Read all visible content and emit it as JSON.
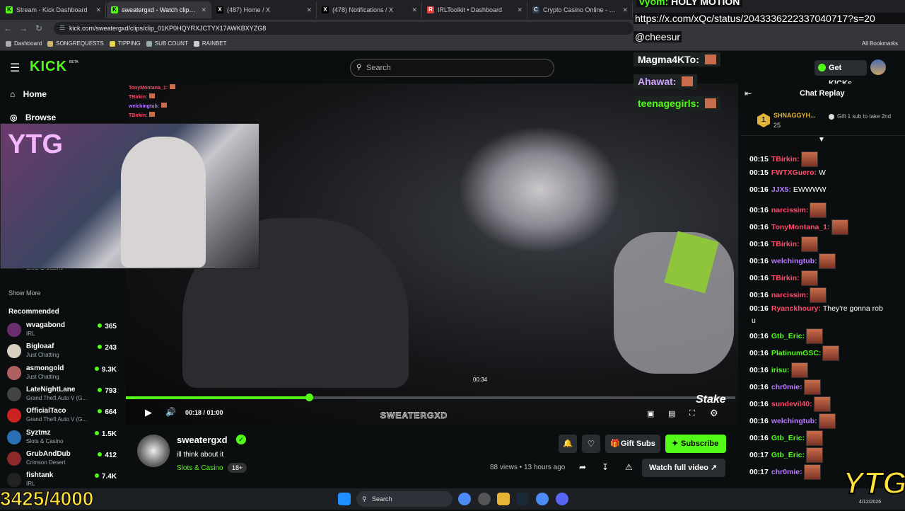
{
  "browser": {
    "tabs": [
      {
        "label": "Stream - Kick Dashboard",
        "fav": "K",
        "color": "#53fc18"
      },
      {
        "label": "sweatergxd - Watch clips on",
        "fav": "K",
        "color": "#53fc18"
      },
      {
        "label": "(487) Home / X",
        "fav": "X",
        "color": "#000000"
      },
      {
        "label": "(478) Notifications / X",
        "fav": "X",
        "color": "#000000"
      },
      {
        "label": "IRLToolkit • Dashboard",
        "fav": "R",
        "color": "#e53935"
      },
      {
        "label": "Crypto Casino Online - Play with",
        "fav": "C",
        "color": "#2d3b4f"
      }
    ],
    "url": "kick.com/sweatergxd/clips/clip_01KP0HQYRXJCTYX17AWKBXYZG8",
    "bookmarks": [
      "Dashboard",
      "SONGREQUESTS",
      "TIPPING",
      "SUB COUNT",
      "RAINBET"
    ],
    "all_bookmarks": "All Bookmarks"
  },
  "kick": {
    "logo": "KICK",
    "beta": "BETA",
    "search_placeholder": "Search",
    "get_kicks": "Get KICKs",
    "nav": {
      "home": "Home",
      "browse": "Browse"
    }
  },
  "sidebar": {
    "partial": {
      "name": "Syztmz",
      "category": "Slots & Casino",
      "viewers": "1.5K"
    },
    "show_more": "Show More",
    "recommended_title": "Recommended",
    "recommended": [
      {
        "name": "wvagabond",
        "category": "IRL",
        "viewers": "365",
        "color": "#6a2d6e"
      },
      {
        "name": "Bigloaaf",
        "category": "Just Chatting",
        "viewers": "243",
        "color": "#d8d0c0"
      },
      {
        "name": "asmongold",
        "category": "Just Chatting",
        "viewers": "9.3K",
        "color": "#b06060"
      },
      {
        "name": "LateNightLane",
        "category": "Grand Theft Auto V (G...",
        "viewers": "793",
        "color": "#444"
      },
      {
        "name": "OfficialTaco",
        "category": "Grand Theft Auto V (G...",
        "viewers": "664",
        "color": "#c22"
      },
      {
        "name": "Syztmz",
        "category": "Slots & Casino",
        "viewers": "1.5K",
        "color": "#2b6fb5"
      },
      {
        "name": "GrubAndDub",
        "category": "Crimson Desert",
        "viewers": "412",
        "color": "#8a2a2a"
      },
      {
        "name": "fishtank",
        "category": "IRL",
        "viewers": "7.4K",
        "color": "#222"
      }
    ]
  },
  "player": {
    "time_current": "00:18",
    "time_total": "01:00",
    "hover_time": "00:34",
    "progress": 0.3,
    "watermark": "SWEATERGXD",
    "stake": "Stake"
  },
  "mini_chat": [
    {
      "u": "TonyMontana_1:",
      "c": "#ff4a6a"
    },
    {
      "u": "TBirkin:",
      "c": "#ff4a6a"
    },
    {
      "u": "welchingtub:",
      "c": "#b77bff"
    },
    {
      "u": "TBirkin:",
      "c": "#ff4a6a"
    }
  ],
  "overlay": {
    "name": "vyom:",
    "msg": "HOLY MOTION",
    "link": "https://x.com/xQc/status/2043336222337040717?s=20",
    "mention": "@cheesur",
    "lines": [
      {
        "u": "Magma4KTo:",
        "c": "#ffffff"
      },
      {
        "u": "Ahawat:",
        "c": "#cfa3ff"
      },
      {
        "u": "teenagegirls:",
        "c": "#53fc18"
      }
    ],
    "counter": "3425/4000",
    "brand": "YTG"
  },
  "clip_info": {
    "channel": "sweatergxd",
    "title": "ill think about it",
    "category": "Slots & Casino",
    "age_badge": "18+",
    "gift_subs": "Gift Subs",
    "subscribe": "Subscribe",
    "views": "88 views",
    "time_ago": "13 hours ago",
    "watch_full": "Watch full video"
  },
  "chat": {
    "title": "Chat Replay",
    "gifter": {
      "name": "SHNAGGYH...",
      "count": "25",
      "rank": "1"
    },
    "gift_cta": "Gift 1 sub to take 2nd",
    "messages": [
      {
        "t": "00:15",
        "u": "TBirkin:",
        "c": "#ff4a6a",
        "text": "",
        "emote": true
      },
      {
        "t": "00:15",
        "u": "FWTXGuero:",
        "c": "#ff4a6a",
        "text": "W",
        "emote": false
      },
      {
        "t": "00:16",
        "u": "JJX5:",
        "c": "#b77bff",
        "text": "EWWWW",
        "emote": false
      },
      {
        "t": "00:16",
        "u": "narcissim:",
        "c": "#ff4a6a",
        "text": "",
        "emote": true
      },
      {
        "t": "00:16",
        "u": "TonyMontana_1:",
        "c": "#ff4a6a",
        "text": "",
        "emote": true
      },
      {
        "t": "00:16",
        "u": "TBirkin:",
        "c": "#ff4a6a",
        "text": "",
        "emote": true
      },
      {
        "t": "00:16",
        "u": "welchingtub:",
        "c": "#b77bff",
        "text": "",
        "emote": true
      },
      {
        "t": "00:16",
        "u": "TBirkin:",
        "c": "#ff4a6a",
        "text": "",
        "emote": true
      },
      {
        "t": "00:16",
        "u": "narcissim:",
        "c": "#ff4a6a",
        "text": "",
        "emote": true
      },
      {
        "t": "00:16",
        "u": "Ryanckhoury:",
        "c": "#ff4a6a",
        "text": "They're gonna rob",
        "emote": false
      },
      {
        "t": "",
        "u": "",
        "c": "#fff",
        "text": "u",
        "emote": false
      },
      {
        "t": "00:16",
        "u": "Gtb_Eric:",
        "c": "#53fc18",
        "text": "",
        "emote": true
      },
      {
        "t": "00:16",
        "u": "PlatinumGSC:",
        "c": "#53fc18",
        "text": "",
        "emote": true
      },
      {
        "t": "00:16",
        "u": "irisu:",
        "c": "#53fc18",
        "text": "",
        "emote": true
      },
      {
        "t": "00:16",
        "u": "chr0mie:",
        "c": "#b77bff",
        "text": "",
        "emote": true
      },
      {
        "t": "00:16",
        "u": "sundevil40:",
        "c": "#ff4a6a",
        "text": "",
        "emote": true
      },
      {
        "t": "00:16",
        "u": "welchingtub:",
        "c": "#b77bff",
        "text": "",
        "emote": true
      },
      {
        "t": "00:16",
        "u": "Gtb_Eric:",
        "c": "#53fc18",
        "text": "",
        "emote": true
      },
      {
        "t": "00:17",
        "u": "Gtb_Eric:",
        "c": "#53fc18",
        "text": "",
        "emote": true
      },
      {
        "t": "00:17",
        "u": "chr0mie:",
        "c": "#b77bff",
        "text": "",
        "emote": true
      }
    ]
  },
  "taskbar": {
    "search": "Search",
    "date": "4/12/2026"
  }
}
